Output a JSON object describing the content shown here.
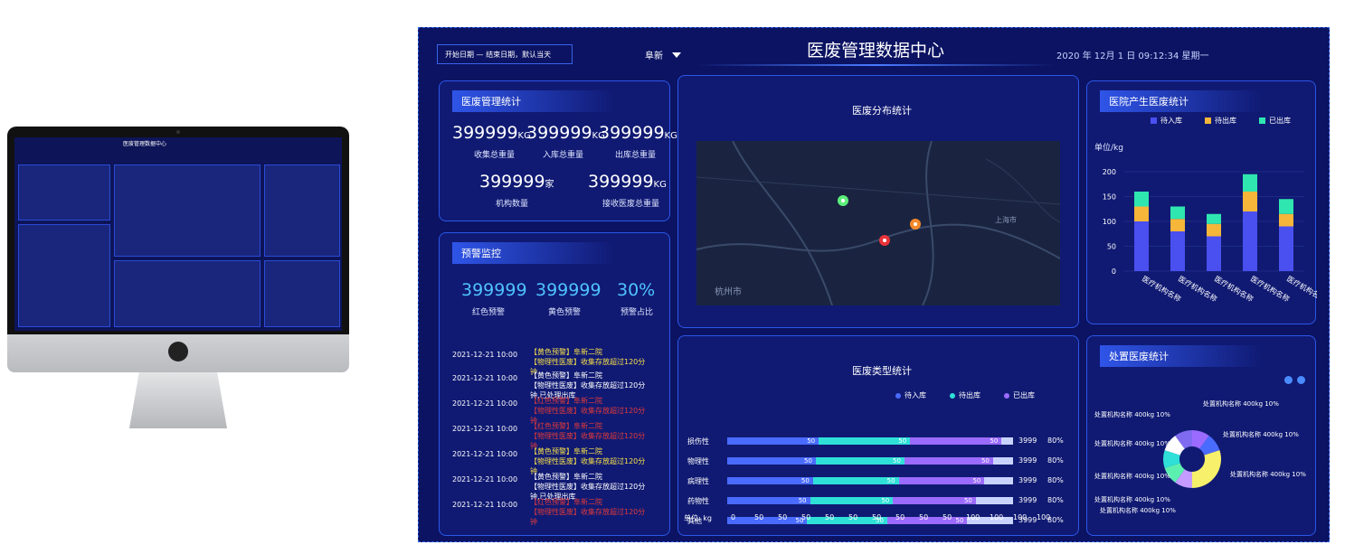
{
  "header": {
    "title": "医废管理数据中心",
    "date_range": "开始日期 — 结束日期，默认当天",
    "region": "阜新",
    "datetime": "2020 年 12月 1 日   09:12:34    星期一"
  },
  "stats": {
    "title": "医废管理统计",
    "items": [
      {
        "value": "399999",
        "unit": "KG",
        "label": "收集总重量"
      },
      {
        "value": "399999",
        "unit": "KG",
        "label": "入库总重量"
      },
      {
        "value": "399999",
        "unit": "KG",
        "label": "出库总重量"
      },
      {
        "value": "399999",
        "unit": "家",
        "label": "机构数量"
      },
      {
        "value": "399999",
        "unit": "KG",
        "label": "接收医废总重量"
      }
    ]
  },
  "warning": {
    "title": "预警监控",
    "items": [
      {
        "value": "399999",
        "label": "红色预警"
      },
      {
        "value": "399999",
        "label": "黄色预警"
      },
      {
        "value": "30%",
        "label": "预警占比"
      }
    ],
    "list": [
      {
        "time": "2021-12-21 10:00",
        "color": "yellow",
        "line1": "【黄色预警】阜新二院",
        "line2": "【物理性医废】收集存放超过120分钟"
      },
      {
        "time": "2021-12-21 10:00",
        "color": "white",
        "line1": "【黄色预警】阜新二院",
        "line2": "【物理性医废】收集存放超过120分钟,已处理出库"
      },
      {
        "time": "2021-12-21 10:00",
        "color": "red",
        "line1": "【红色预警】阜新二院",
        "line2": "【物理性医废】收集存放超过120分钟"
      },
      {
        "time": "2021-12-21 10:00",
        "color": "red",
        "line1": "【红色预警】阜新二院",
        "line2": "【物理性医废】收集存放超过120分钟"
      },
      {
        "time": "2021-12-21 10:00",
        "color": "yellow",
        "line1": "【黄色预警】阜新二院",
        "line2": "【物理性医废】收集存放超过120分钟"
      },
      {
        "time": "2021-12-21 10:00",
        "color": "white",
        "line1": "【黄色预警】阜新二院",
        "line2": "【物理性医废】收集存放超过120分钟,已处理出库"
      },
      {
        "time": "2021-12-21 10:00",
        "color": "red",
        "line1": "【红色预警】阜新二院",
        "line2": "【物理性医废】收集存放超过120分钟"
      }
    ]
  },
  "map": {
    "title": "医废分布统计",
    "city_label": "杭州市",
    "city_label2": "上海市"
  },
  "hospital_chart": {
    "title": "医院产生医废统计",
    "unit": "单位/kg",
    "chart_data": {
      "type": "bar",
      "categories": [
        "医疗机构名称",
        "医疗机构名称",
        "医疗机构名称",
        "医疗机构名称",
        "医疗机构名称"
      ],
      "series": [
        {
          "name": "待入库",
          "values": [
            100,
            80,
            70,
            120,
            90
          ],
          "color": "#4a4ff0"
        },
        {
          "name": "待出库",
          "values": [
            30,
            25,
            25,
            40,
            25
          ],
          "color": "#f5b63a"
        },
        {
          "name": "已出库",
          "values": [
            30,
            25,
            20,
            35,
            30
          ],
          "color": "#2fe6b0"
        }
      ],
      "ylim": [
        0,
        200
      ],
      "yticks": [
        0,
        50,
        100,
        150,
        200
      ]
    }
  },
  "type_chart": {
    "title": "医废类型统计",
    "unit": "单位: kg",
    "legend": [
      {
        "name": "待入库",
        "color": "#4a6bff"
      },
      {
        "name": "待出库",
        "color": "#2fe0d8"
      },
      {
        "name": "已出库",
        "color": "#9b6bff"
      }
    ],
    "chart_data": {
      "type": "bar",
      "categories": [
        "损伤性",
        "物理性",
        "病理性",
        "药物性",
        "其他"
      ],
      "series": [
        {
          "name": "待入库",
          "values": [
            50,
            50,
            50,
            50,
            50
          ]
        },
        {
          "name": "待出库",
          "values": [
            50,
            50,
            50,
            50,
            50
          ]
        },
        {
          "name": "已出库",
          "values": [
            50,
            50,
            50,
            50,
            50
          ]
        }
      ],
      "totals": [
        "3999",
        "3999",
        "3999",
        "3999",
        "3999"
      ],
      "percents": [
        "80%",
        "80%",
        "80%",
        "80%",
        "80%"
      ],
      "xticks": [
        "0",
        "50",
        "50",
        "50",
        "50",
        "50",
        "50",
        "50",
        "50",
        "50",
        "100",
        "100",
        "100",
        "100"
      ]
    }
  },
  "disposal": {
    "title": "处置医废统计",
    "chart_data": {
      "type": "pie",
      "slices": [
        {
          "label": "处置机构名称  400kg  10%",
          "value": 10,
          "color": "#9b6bff"
        },
        {
          "label": "处置机构名称  400kg  10%",
          "value": 10,
          "color": "#4a6bff"
        },
        {
          "label": "处置机构名称  400kg  10%",
          "value": 30,
          "color": "#f7f06a"
        },
        {
          "label": "处置机构名称  400kg  10%",
          "value": 10,
          "color": "#c59bff"
        },
        {
          "label": "处置机构名称  400kg  10%",
          "value": 10,
          "color": "#5cf0b0"
        },
        {
          "label": "处置机构名称  400kg  10%",
          "value": 10,
          "color": "#2fe0d8"
        },
        {
          "label": "处置机构名称  400kg  10%",
          "value": 10,
          "color": "#ffffff"
        },
        {
          "label": "处置机构名称  400kg  10%",
          "value": 10,
          "color": "#7f6bf0"
        }
      ]
    }
  }
}
